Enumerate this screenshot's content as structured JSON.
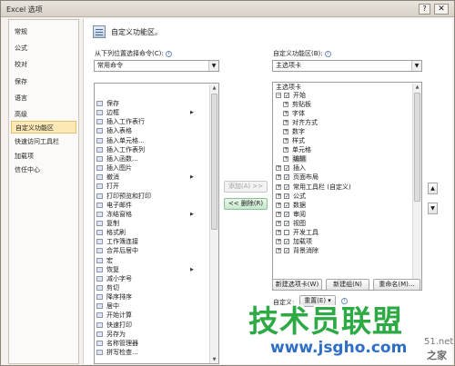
{
  "window": {
    "title": "Excel 选项",
    "help_label": "?",
    "close_label": "✕"
  },
  "sidebar": {
    "items": [
      {
        "label": "常规"
      },
      {
        "label": "公式"
      },
      {
        "label": "校对"
      },
      {
        "label": "保存"
      },
      {
        "label": "语言"
      },
      {
        "label": "高级"
      },
      {
        "label": "自定义功能区"
      },
      {
        "label": "快速访问工具栏"
      },
      {
        "label": "加载项"
      },
      {
        "label": "信任中心"
      }
    ],
    "active_index": 6
  },
  "main": {
    "heading": "自定义功能区。",
    "left": {
      "label": "从下列位置选择命令(C):",
      "combo_value": "常用命令",
      "commands": [
        {
          "label": "保存",
          "icon": "save-icon"
        },
        {
          "label": "边框",
          "icon": "border-icon",
          "submenu": "▶"
        },
        {
          "label": "插入工作表行",
          "icon": "insert-row-icon"
        },
        {
          "label": "插入表格",
          "icon": "insert-table-icon"
        },
        {
          "label": "插入单元格...",
          "icon": "insert-cell-icon"
        },
        {
          "label": "插入工作表列",
          "icon": "insert-column-icon"
        },
        {
          "label": "插入函数...",
          "icon": "function-icon"
        },
        {
          "label": "插入图片",
          "icon": "picture-icon"
        },
        {
          "label": "撤消",
          "icon": "undo-icon",
          "submenu": "▶"
        },
        {
          "label": "打开",
          "icon": "open-icon"
        },
        {
          "label": "打印预览和打印",
          "icon": "print-preview-icon"
        },
        {
          "label": "电子邮件",
          "icon": "email-icon"
        },
        {
          "label": "冻结窗格",
          "icon": "freeze-icon",
          "submenu": "▶"
        },
        {
          "label": "复制",
          "icon": "copy-icon"
        },
        {
          "label": "格式刷",
          "icon": "format-painter-icon"
        },
        {
          "label": "工作簿连接",
          "icon": "connections-icon"
        },
        {
          "label": "合并后居中",
          "icon": "merge-icon"
        },
        {
          "label": "宏",
          "icon": "macro-icon"
        },
        {
          "label": "恢复",
          "icon": "redo-icon",
          "submenu": "▶"
        },
        {
          "label": "减小字号",
          "icon": "font-smaller-icon"
        },
        {
          "label": "剪切",
          "icon": "cut-icon"
        },
        {
          "label": "降序排序",
          "icon": "sort-desc-icon"
        },
        {
          "label": "居中",
          "icon": "center-icon"
        },
        {
          "label": "开始计算",
          "icon": "calculate-icon"
        },
        {
          "label": "快速打印",
          "icon": "quick-print-icon"
        },
        {
          "label": "另存为",
          "icon": "save-as-icon"
        },
        {
          "label": "名称管理器",
          "icon": "name-manager-icon"
        },
        {
          "label": "拼写检查...",
          "icon": "spelling-icon"
        }
      ]
    },
    "buttons": {
      "add": "添加(A) >>",
      "remove": "<< 删除(R)"
    },
    "right": {
      "label": "自定义功能区(B):",
      "combo_value": "主选项卡",
      "tree_header": "主选项卡",
      "tree": [
        {
          "label": "开始",
          "level": 0,
          "expander": "⊟",
          "checked": true
        },
        {
          "label": "剪贴板",
          "level": 1,
          "expander": "⊞"
        },
        {
          "label": "字体",
          "level": 1,
          "expander": "⊞"
        },
        {
          "label": "对齐方式",
          "level": 1,
          "expander": "⊞"
        },
        {
          "label": "数字",
          "level": 1,
          "expander": "⊞"
        },
        {
          "label": "样式",
          "level": 1,
          "expander": "⊞"
        },
        {
          "label": "单元格",
          "level": 1,
          "expander": "⊞"
        },
        {
          "label": "编辑",
          "level": 1,
          "expander": "⊞",
          "selected": true
        },
        {
          "label": "插入",
          "level": 0,
          "expander": "⊞",
          "checked": true
        },
        {
          "label": "页面布局",
          "level": 0,
          "expander": "⊞",
          "checked": true
        },
        {
          "label": "常用工具栏 (自定义)",
          "level": 0,
          "expander": "⊞",
          "checked": true
        },
        {
          "label": "公式",
          "level": 0,
          "expander": "⊞",
          "checked": true
        },
        {
          "label": "数据",
          "level": 0,
          "expander": "⊞",
          "checked": true
        },
        {
          "label": "审阅",
          "level": 0,
          "expander": "⊞",
          "checked": true
        },
        {
          "label": "视图",
          "level": 0,
          "expander": "⊞",
          "checked": true
        },
        {
          "label": "开发工具",
          "level": 0,
          "expander": "⊞",
          "checked": false
        },
        {
          "label": "加载项",
          "level": 0,
          "expander": "⊞",
          "checked": true
        },
        {
          "label": "背景消除",
          "level": 0,
          "expander": "⊞",
          "checked": true
        }
      ],
      "new_tab": "新建选项卡(W)",
      "new_group": "新建组(N)",
      "rename": "重命名(M)...",
      "customize_label": "自定义:",
      "reset": "重置(E) ▾",
      "move_up": "▲",
      "move_down": "▼"
    }
  },
  "watermark": {
    "text": "技术员联盟",
    "url": "www.jsgho.com",
    "side_top": "51.net",
    "side_bottom": "之家"
  }
}
